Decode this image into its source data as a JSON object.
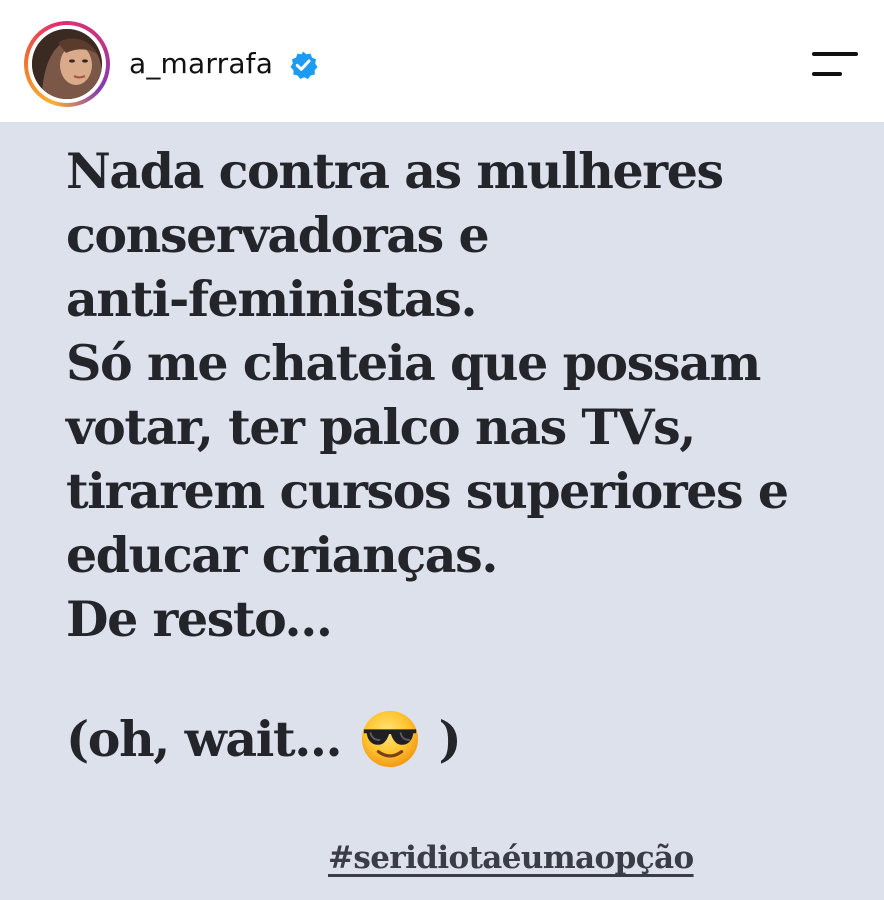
{
  "header": {
    "username": "a_marrafa",
    "verified_icon": "verified-badge-icon",
    "menu_icon": "menu-icon",
    "verified_color": "#1d9bf0"
  },
  "story": {
    "background_color": "#dde1ec",
    "text_color": "#24252a",
    "lines": [
      "Nada contra as mulheres",
      "conservadoras e",
      "anti-feministas.",
      "Só me chateia que possam",
      "votar, ter palco nas TVs,",
      "tirarem cursos superiores e",
      "educar crianças.",
      "De resto..."
    ],
    "wait_open": "(oh, wait...",
    "wait_emoji": "sunglasses-emoji",
    "wait_close": ")",
    "hashtag": "#seridiotaéumaopção"
  }
}
